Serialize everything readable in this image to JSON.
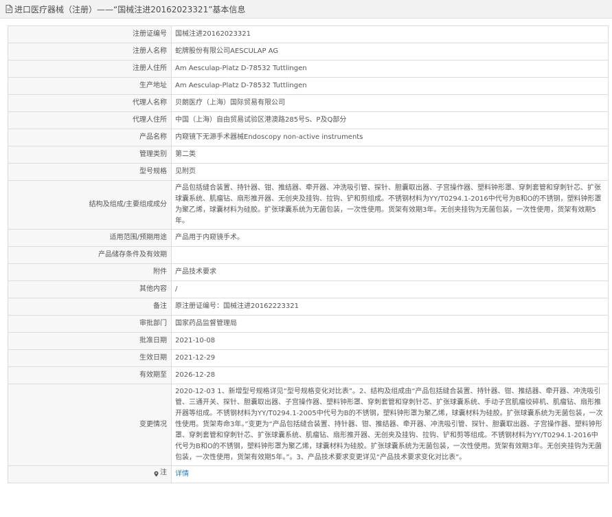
{
  "header": {
    "title": "进口医疗器械（注册）——“国械注进20162023321”基本信息"
  },
  "rows": [
    {
      "label": "注册证编号",
      "value": "国械注进20162023321"
    },
    {
      "label": "注册人名称",
      "value": "蛇牌股份有限公司AESCULAP AG"
    },
    {
      "label": "注册人住所",
      "value": "Am Aesculap-Platz D-78532 Tuttlingen"
    },
    {
      "label": "生产地址",
      "value": "Am Aesculap-Platz D-78532 Tuttlingen"
    },
    {
      "label": "代理人名称",
      "value": "贝朗医疗（上海）国际贸易有限公司"
    },
    {
      "label": "代理人住所",
      "value": "中国（上海）自由贸易试验区港澳路285号S、P及Q部分"
    },
    {
      "label": "产品名称",
      "value": "内窥镜下无源手术器械Endoscopy non-active instruments"
    },
    {
      "label": "管理类别",
      "value": "第二类"
    },
    {
      "label": "型号规格",
      "value": "见附页"
    },
    {
      "label": "结构及组成/主要组成成分",
      "value": "产品包括缝合装置、持针器、钳、推结器、牵开器、冲洗吸引管、探针、胆囊取出器、子宫操作器、塑料钟形罩、穿刺套管和穿刺针芯、扩张球囊系统、肌瘤钻、扇形推开器、无创夹及挂钩、拉钩、铲和剪组成。不锈钢材料为YY/T0294.1-2016中代号为B和O的不锈钢，塑料钟形罩为聚乙烯，球囊材料为硅胶。扩张球囊系统为无菌包装，一次性使用。货架有效期3年。无创夹挂钩为无菌包装，一次性使用，货架有效期5年。"
    },
    {
      "label": "适用范围/预期用途",
      "value": "产品用于内窥镜手术。"
    },
    {
      "label": "产品储存条件及有效期",
      "value": ""
    },
    {
      "label": "附件",
      "value": "产品技术要求"
    },
    {
      "label": "其他内容",
      "value": "/"
    },
    {
      "label": "备注",
      "value": "原注册证编号：国械注进20162223321"
    },
    {
      "label": "审批部门",
      "value": "国家药品监督管理局"
    },
    {
      "label": "批准日期",
      "value": "2021-10-08"
    },
    {
      "label": "生效日期",
      "value": "2021-12-29"
    },
    {
      "label": "有效期至",
      "value": "2026-12-28"
    },
    {
      "label": "变更情况",
      "value": "2020-12-03 1、新增型号规格详见“型号规格变化对比表”。2、结构及组成由“产品包括缝合装置、持针器、钳、推结器、牵开器、冲洗吸引管、三通开关、探针、胆囊取出器、子宫操作器、塑料钟形罩、穿刺套管和穿刺针芯、扩张球囊系统、手动子宫肌瘤绞碎机、肌瘤钻、扇形推开器等组成。不锈钢材料为YY/T0294.1-2005中代号为B的不锈钢，塑料钟形罩为聚乙烯，球囊材料为硅胶。扩张球囊系统为无菌包装，一次性使用。货架寿命3年。”变更为“产品包括缝合装置、持针器、钳、推结器、牵开器、冲洗吸引管、探针、胆囊取出器、子宫操作器、塑料钟形罩、穿刺套管和穿刺针芯、扩张球囊系统、肌瘤钻、扇形推开器、无创夹及挂钩、拉钩、铲和剪等组成。不锈钢材料为YY/T0294.1-2016中代号为B和O的不锈钢，塑料钟形罩为聚乙烯，球囊材料为硅胶。扩张球囊系统为无菌包装，一次性使用。货架有效期3年。无创夹挂钩为无菌包装，一次性使用，货架有效期5年。”。3、产品技术要求变更详见“产品技术要求变化对比表”。"
    }
  ],
  "note_row": {
    "label": "注",
    "link": "详情"
  },
  "colors": {
    "header_bg": "#f2f2f2",
    "border": "#dcdcdc",
    "link": "#2a7ab9"
  },
  "icons": {
    "header": "document-icon",
    "note": "pin-icon"
  }
}
